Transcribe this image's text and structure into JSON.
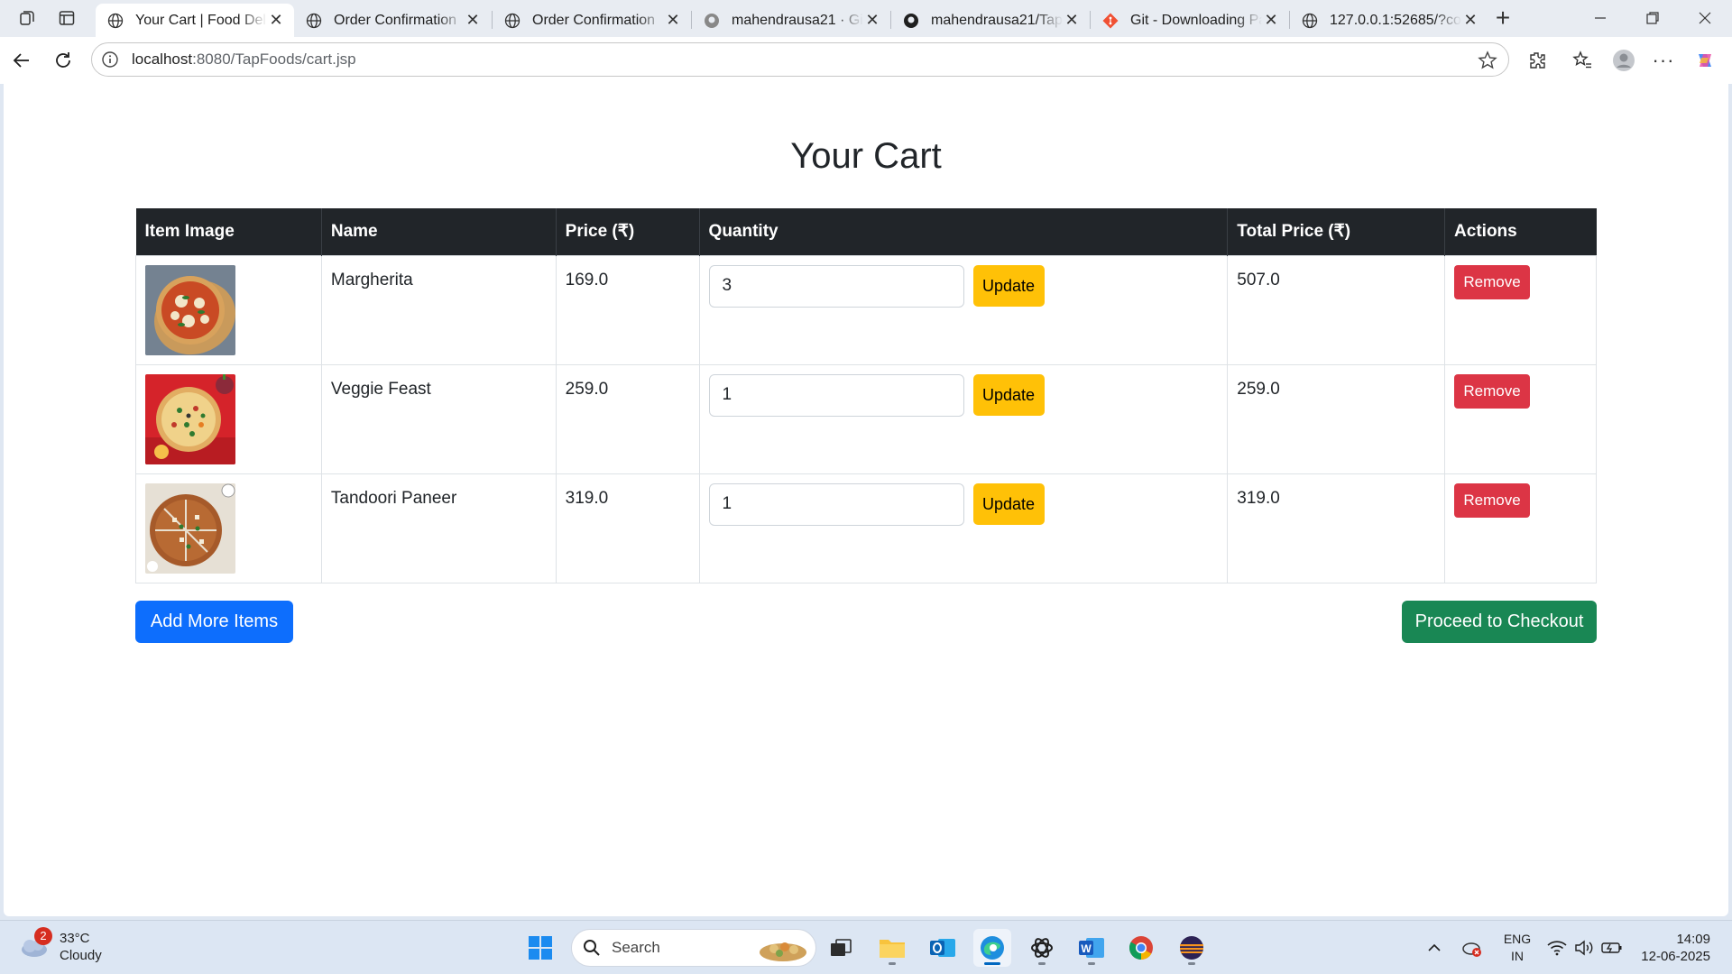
{
  "browser": {
    "tabs": [
      {
        "title": "Your Cart | Food Delivery",
        "active": true,
        "icon": "globe-icon"
      },
      {
        "title": "Order Confirmation",
        "active": false,
        "icon": "globe-icon"
      },
      {
        "title": "Order Confirmation",
        "active": false,
        "icon": "globe-icon"
      },
      {
        "title": "mahendrausa21 · GitHub",
        "active": false,
        "icon": "github-icon"
      },
      {
        "title": "mahendrausa21/TapFoods",
        "active": false,
        "icon": "github-icon"
      },
      {
        "title": "Git - Downloading Package",
        "active": false,
        "icon": "git-icon"
      },
      {
        "title": "127.0.0.1:52685/?code",
        "active": false,
        "icon": "globe-icon"
      }
    ],
    "close_glyph": "✕",
    "new_tab_glyph": "+",
    "url_host": "localhost",
    "url_rest": ":8080/TapFoods/cart.jsp"
  },
  "page": {
    "title": "Your Cart",
    "table": {
      "headers": [
        "Item Image",
        "Name",
        "Price (₹)",
        "Quantity",
        "Total Price (₹)",
        "Actions"
      ],
      "rows": [
        {
          "name": "Margherita",
          "price": "169.0",
          "quantity": "3",
          "total": "507.0",
          "image": "margherita-pizza"
        },
        {
          "name": "Veggie Feast",
          "price": "259.0",
          "quantity": "1",
          "total": "259.0",
          "image": "veggie-feast-pizza"
        },
        {
          "name": "Tandoori Paneer",
          "price": "319.0",
          "quantity": "1",
          "total": "319.0",
          "image": "tandoori-paneer-pizza"
        }
      ],
      "update_label": "Update",
      "remove_label": "Remove"
    },
    "add_more_label": "Add More Items",
    "checkout_label": "Proceed to Checkout"
  },
  "colors": {
    "header_bg": "#212529",
    "update": "#ffc107",
    "remove": "#dc3545",
    "primary": "#0d6efd",
    "success": "#198754"
  },
  "taskbar": {
    "weather_temp": "33°C",
    "weather_cond": "Cloudy",
    "weather_badge": "2",
    "search_placeholder": "Search",
    "lang_1": "ENG",
    "lang_2": "IN",
    "time": "14:09",
    "date": "12-06-2025"
  }
}
